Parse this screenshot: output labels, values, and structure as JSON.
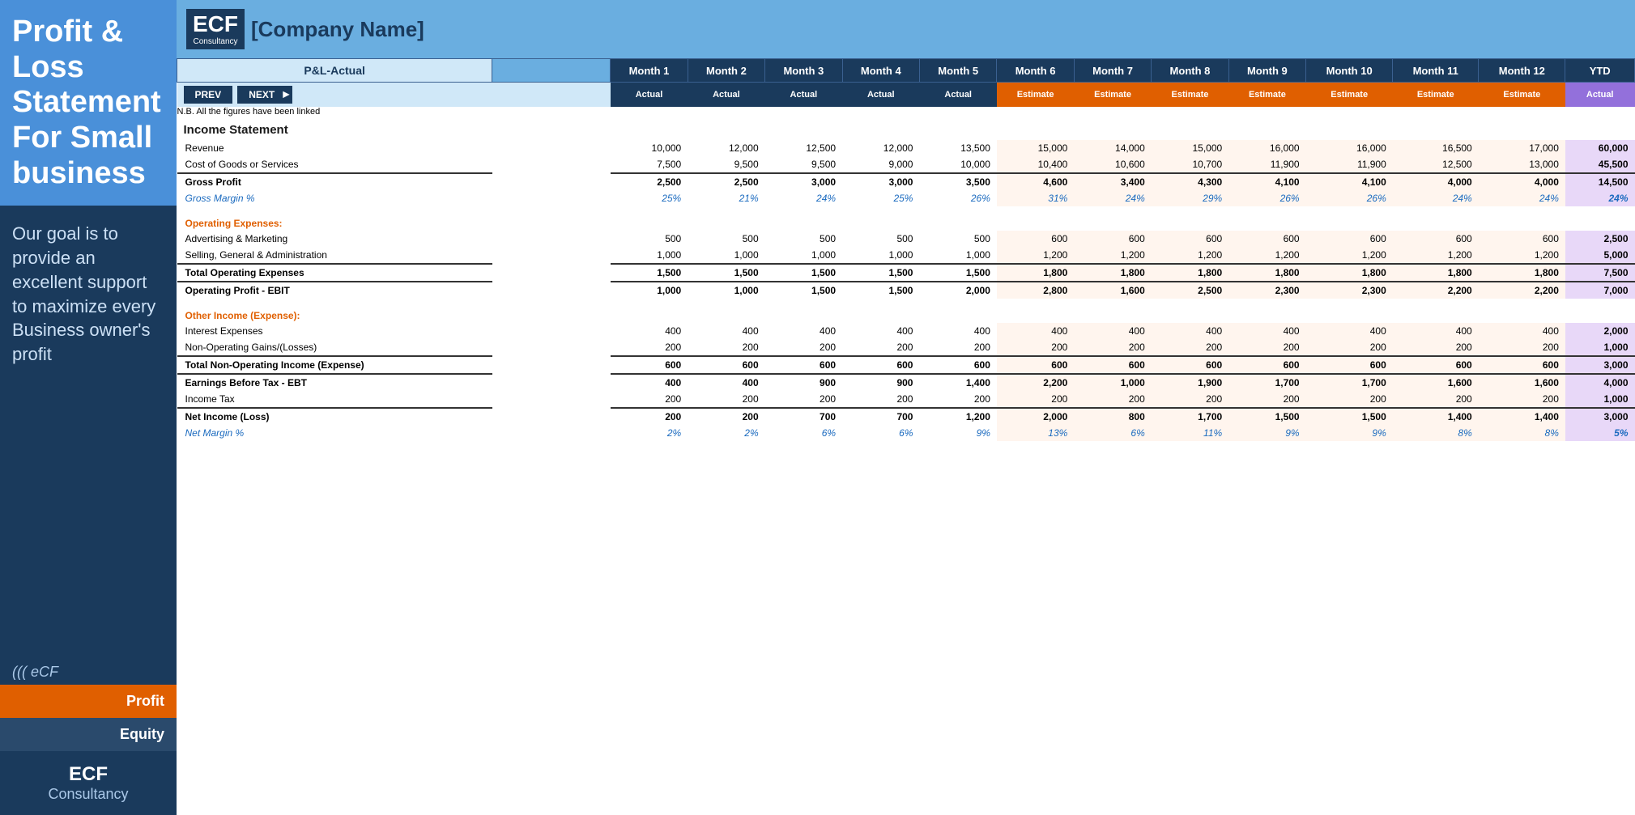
{
  "sidebar": {
    "title": "Profit & Loss Statement For Small business",
    "goal_text": "Our goal is to provide an excellent support to maximize every Business owner's profit",
    "logo_text": "((( eCF",
    "nav_items": [
      {
        "label": "Profit",
        "type": "profit"
      },
      {
        "label": "Equity",
        "type": "equity"
      }
    ],
    "footer_title": "ECF",
    "footer_sub": "Consultancy"
  },
  "header": {
    "logo_main": "ECF",
    "logo_sub": "Consultancy",
    "company_name": "[Company Name]"
  },
  "table": {
    "pl_actual_label": "P&L-Actual",
    "nav_prev": "PREV",
    "nav_next": "NEXT",
    "note": "N.B. All the figures have been linked",
    "month_headers": [
      "Month 1",
      "Month 2",
      "Month 3",
      "Month 4",
      "Month 5",
      "Month 6",
      "Month 7",
      "Month 8",
      "Month 9",
      "Month 10",
      "Month 11",
      "Month 12",
      "YTD"
    ],
    "row2_headers": [
      "Actual",
      "Actual",
      "Actual",
      "Actual",
      "Actual",
      "Estimate",
      "Estimate",
      "Estimate",
      "Estimate",
      "Estimate",
      "Estimate",
      "Estimate",
      "Actual"
    ],
    "income_statement_label": "Income Statement",
    "rows": {
      "revenue": {
        "label": "Revenue",
        "values": [
          "10,000",
          "12,000",
          "12,500",
          "12,000",
          "13,500",
          "15,000",
          "14,000",
          "15,000",
          "16,000",
          "16,000",
          "16,500",
          "17,000",
          "60,000"
        ]
      },
      "cogs": {
        "label": "Cost of Goods or Services",
        "values": [
          "7,500",
          "9,500",
          "9,500",
          "9,000",
          "10,000",
          "10,400",
          "10,600",
          "10,700",
          "11,900",
          "11,900",
          "12,500",
          "13,000",
          "45,500"
        ]
      },
      "gross_profit": {
        "label": "Gross Profit",
        "values": [
          "2,500",
          "2,500",
          "3,000",
          "3,000",
          "3,500",
          "4,600",
          "3,400",
          "4,300",
          "4,100",
          "4,100",
          "4,000",
          "4,000",
          "14,500"
        ]
      },
      "gross_margin": {
        "label": "Gross Margin %",
        "values": [
          "25%",
          "21%",
          "24%",
          "25%",
          "26%",
          "31%",
          "24%",
          "29%",
          "26%",
          "26%",
          "24%",
          "24%",
          "24%"
        ]
      },
      "op_expenses_header": "Operating Expenses:",
      "advertising": {
        "label": "Advertising & Marketing",
        "values": [
          "500",
          "500",
          "500",
          "500",
          "500",
          "600",
          "600",
          "600",
          "600",
          "600",
          "600",
          "600",
          "2,500"
        ]
      },
      "sga": {
        "label": "Selling, General & Administration",
        "values": [
          "1,000",
          "1,000",
          "1,000",
          "1,000",
          "1,000",
          "1,200",
          "1,200",
          "1,200",
          "1,200",
          "1,200",
          "1,200",
          "1,200",
          "5,000"
        ]
      },
      "total_op_exp": {
        "label": "Total Operating Expenses",
        "values": [
          "1,500",
          "1,500",
          "1,500",
          "1,500",
          "1,500",
          "1,800",
          "1,800",
          "1,800",
          "1,800",
          "1,800",
          "1,800",
          "1,800",
          "7,500"
        ]
      },
      "op_profit": {
        "label": "Operating Profit - EBIT",
        "values": [
          "1,000",
          "1,000",
          "1,500",
          "1,500",
          "2,000",
          "2,800",
          "1,600",
          "2,500",
          "2,300",
          "2,300",
          "2,200",
          "2,200",
          "7,000"
        ]
      },
      "other_income_header": "Other Income (Expense):",
      "interest": {
        "label": "Interest Expenses",
        "values": [
          "400",
          "400",
          "400",
          "400",
          "400",
          "400",
          "400",
          "400",
          "400",
          "400",
          "400",
          "400",
          "2,000"
        ]
      },
      "non_op_gains": {
        "label": "Non-Operating Gains/(Losses)",
        "values": [
          "200",
          "200",
          "200",
          "200",
          "200",
          "200",
          "200",
          "200",
          "200",
          "200",
          "200",
          "200",
          "1,000"
        ]
      },
      "total_non_op": {
        "label": "Total Non-Operating Income (Expense)",
        "values": [
          "600",
          "600",
          "600",
          "600",
          "600",
          "600",
          "600",
          "600",
          "600",
          "600",
          "600",
          "600",
          "3,000"
        ]
      },
      "ebt": {
        "label": "Earnings Before Tax - EBT",
        "values": [
          "400",
          "400",
          "900",
          "900",
          "1,400",
          "2,200",
          "1,000",
          "1,900",
          "1,700",
          "1,700",
          "1,600",
          "1,600",
          "4,000"
        ]
      },
      "income_tax": {
        "label": "Income Tax",
        "values": [
          "200",
          "200",
          "200",
          "200",
          "200",
          "200",
          "200",
          "200",
          "200",
          "200",
          "200",
          "200",
          "1,000"
        ]
      },
      "net_income": {
        "label": "Net Income (Loss)",
        "values": [
          "200",
          "200",
          "700",
          "700",
          "1,200",
          "2,000",
          "800",
          "1,700",
          "1,500",
          "1,500",
          "1,400",
          "1,400",
          "3,000"
        ]
      },
      "net_margin": {
        "label": "Net Margin %",
        "values": [
          "2%",
          "2%",
          "6%",
          "6%",
          "9%",
          "13%",
          "6%",
          "11%",
          "9%",
          "9%",
          "8%",
          "8%",
          "5%"
        ]
      }
    }
  }
}
